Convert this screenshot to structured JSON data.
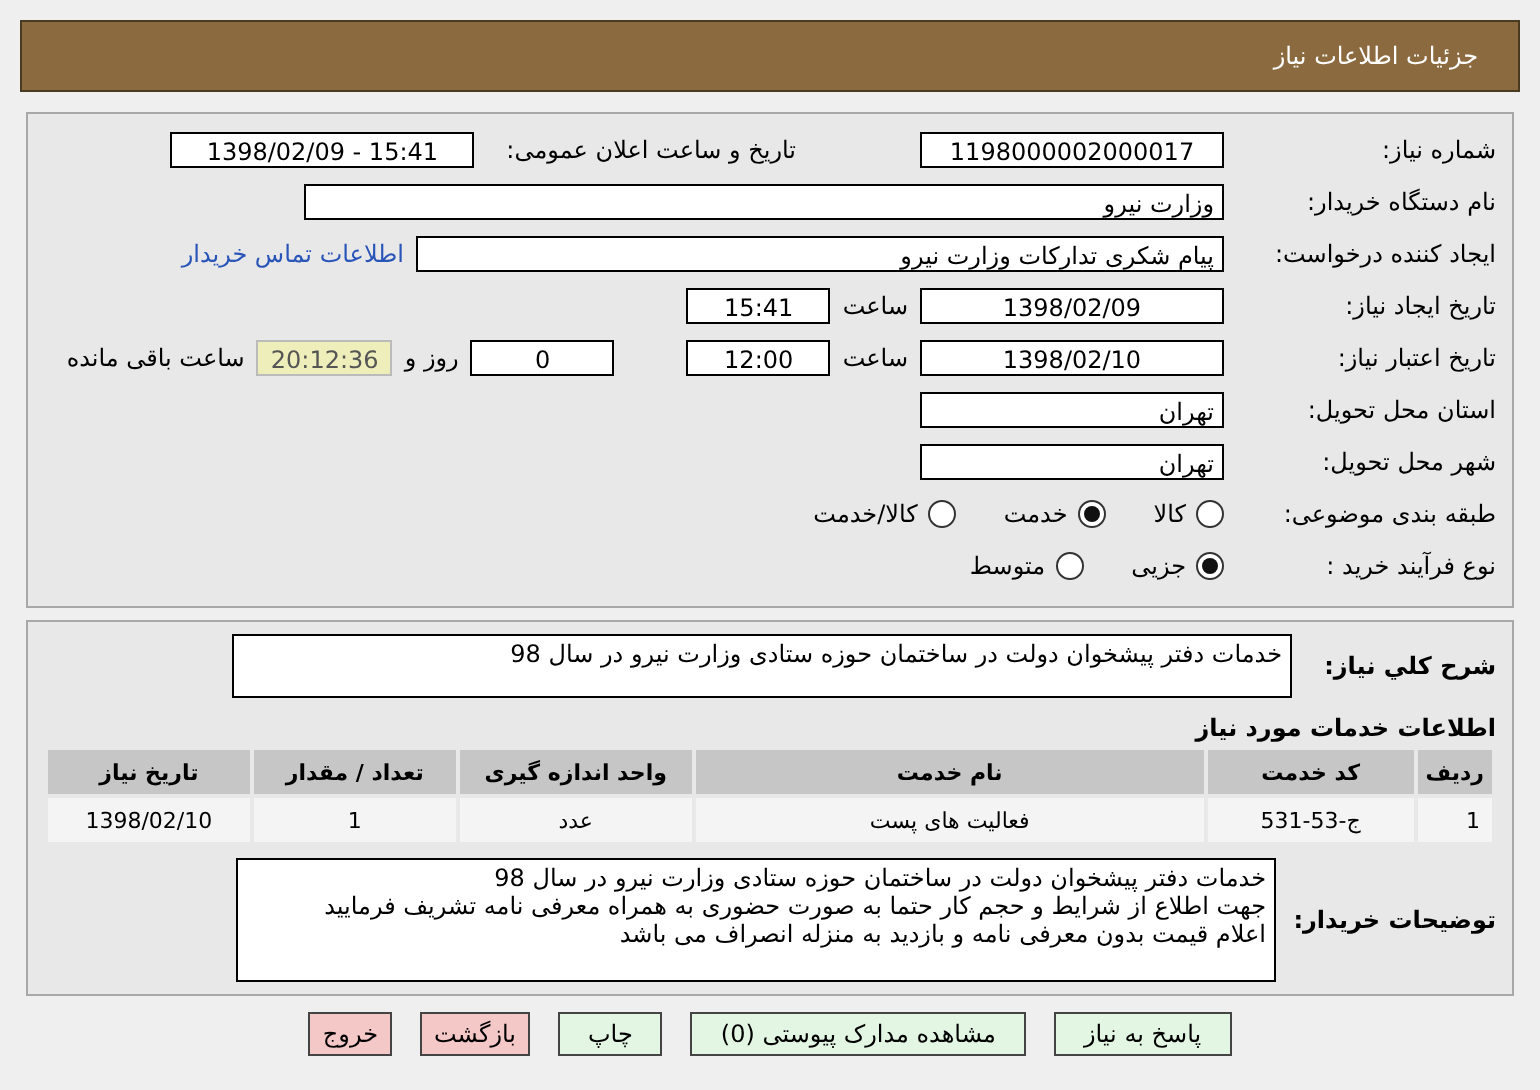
{
  "header": {
    "title": "جزئیات اطلاعات نیاز"
  },
  "need_number": {
    "label": "شماره نیاز:",
    "value": "1198000002000017"
  },
  "announce": {
    "label": "تاریخ و ساعت اعلان عمومی:",
    "value": "1398/02/09 - 15:41"
  },
  "buyer_org": {
    "label": "نام دستگاه خریدار:",
    "value": "وزارت نیرو"
  },
  "requester": {
    "label": "ایجاد کننده درخواست:",
    "value": "پیام شکری تدارکات وزارت نیرو",
    "contact_link": "اطلاعات تماس خریدار"
  },
  "created": {
    "label": "تاریخ ایجاد نیاز:",
    "date": "1398/02/09",
    "time_label": "ساعت",
    "time": "15:41"
  },
  "valid": {
    "label": "تاریخ اعتبار نیاز:",
    "date": "1398/02/10",
    "time_label": "ساعت",
    "time": "12:00",
    "days": "0",
    "days_label": "روز و",
    "remaining": "20:12:36",
    "remaining_label": "ساعت باقی مانده"
  },
  "province": {
    "label": "استان محل تحویل:",
    "value": "تهران"
  },
  "city": {
    "label": "شهر محل تحویل:",
    "value": "تهران"
  },
  "category": {
    "label": "طبقه بندی موضوعی:",
    "options": [
      {
        "label": "کالا",
        "selected": false
      },
      {
        "label": "خدمت",
        "selected": true
      },
      {
        "label": "کالا/خدمت",
        "selected": false
      }
    ]
  },
  "process": {
    "label": "نوع فرآیند خرید :",
    "options": [
      {
        "label": "جزیی",
        "selected": true
      },
      {
        "label": "متوسط",
        "selected": false
      }
    ]
  },
  "summary": {
    "label": "شرح کلي نیاز:",
    "value": "خدمات دفتر پیشخوان دولت در ساختمان حوزه ستادی وزارت نیرو در سال 98"
  },
  "services": {
    "title": "اطلاعات خدمات مورد نیاز",
    "columns": [
      "ردیف",
      "کد خدمت",
      "نام خدمت",
      "واحد اندازه گیری",
      "تعداد / مقدار",
      "تاریخ نیاز"
    ],
    "rows": [
      [
        "1",
        "ج-53-531",
        "فعالیت های پست",
        "عدد",
        "1",
        "1398/02/10"
      ]
    ]
  },
  "buyer_notes": {
    "label": "توضیحات خریدار:",
    "lines": [
      "خدمات دفتر پیشخوان دولت در ساختمان حوزه ستادی وزارت نیرو در سال 98",
      "جهت اطلاع از شرایط و حجم کار حتما به صورت حضوری به همراه معرفی نامه تشریف فرمایید",
      "اعلام قیمت بدون معرفی نامه و بازدید به منزله انصراف می باشد"
    ]
  },
  "buttons": [
    {
      "label": "پاسخ به نیاز",
      "kind": "action"
    },
    {
      "label": "مشاهده مدارک پیوستی (0)",
      "kind": "action"
    },
    {
      "label": "چاپ",
      "kind": "action"
    },
    {
      "label": "بازگشت",
      "kind": "exit"
    },
    {
      "label": "خروج",
      "kind": "exit"
    }
  ]
}
